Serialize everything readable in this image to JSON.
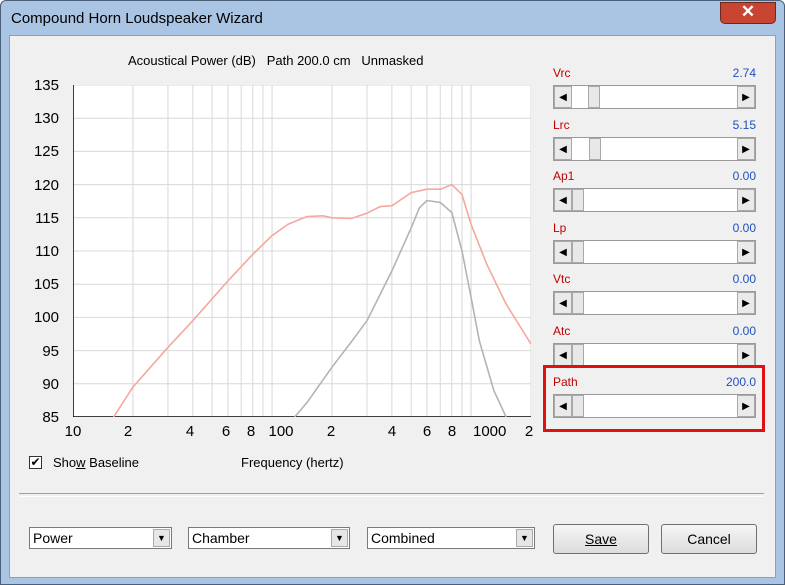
{
  "window": {
    "title": "Compound Horn Loudspeaker Wizard",
    "close_glyph": "✕"
  },
  "chart": {
    "title": "Acoustical Power (dB)   Path 200.0 cm   Unmasked",
    "xaxis_label": "Frequency (hertz)",
    "y_ticks": [
      "135",
      "130",
      "125",
      "120",
      "115",
      "110",
      "105",
      "100",
      "95",
      "90",
      "85"
    ],
    "x_ticks": [
      "10",
      "2",
      "4",
      "6",
      "8",
      "100",
      "2",
      "4",
      "6",
      "8",
      "1000",
      "2"
    ]
  },
  "chart_data": {
    "type": "line",
    "title": "Acoustical Power (dB)   Path 200.0 cm   Unmasked",
    "xlabel": "Frequency (hertz)",
    "ylabel": "",
    "xscale": "log",
    "xlim": [
      10,
      2000
    ],
    "ylim": [
      85,
      135
    ],
    "grid": true,
    "series": [
      {
        "name": "",
        "color": "#f4a8a0",
        "x": [
          16,
          20,
          30,
          40,
          50,
          60,
          80,
          100,
          120,
          150,
          180,
          200,
          250,
          300,
          350,
          400,
          500,
          600,
          700,
          800,
          900,
          1000,
          1200,
          1500,
          2000
        ],
        "y": [
          85,
          89.5,
          95.5,
          99.5,
          102.8,
          105.5,
          109.5,
          112.3,
          114,
          115.2,
          115.3,
          115,
          114.9,
          115.7,
          116.7,
          116.8,
          118.8,
          119.3,
          119.3,
          120,
          118.5,
          114,
          108,
          102,
          96
        ]
      },
      {
        "name": "",
        "color": "#b4b4b4",
        "x": [
          130,
          150,
          200,
          250,
          300,
          400,
          500,
          550,
          600,
          700,
          800,
          900,
          1000,
          1100,
          1300,
          1500
        ],
        "y": [
          85,
          87.2,
          92.5,
          96.3,
          99.5,
          107,
          113.5,
          116.5,
          117.6,
          117.3,
          115.8,
          110,
          103,
          96.5,
          89,
          85
        ]
      }
    ]
  },
  "controls": [
    {
      "label": "Vrc",
      "value": "2.74",
      "level": 0.1
    },
    {
      "label": "Lrc",
      "value": "5.15",
      "level": 0.11
    },
    {
      "label": "Ap1",
      "value": "0.00",
      "level": 0.0
    },
    {
      "label": "Lp",
      "value": "0.00",
      "level": 0.0
    },
    {
      "label": "Vtc",
      "value": "0.00",
      "level": 0.0
    },
    {
      "label": "Atc",
      "value": "0.00",
      "level": 0.0
    },
    {
      "label": "Path",
      "value": "200.0",
      "level": 0.0
    }
  ],
  "show_baseline": {
    "label_pre": "Sho",
    "label_ul": "w",
    "label_post": " Baseline",
    "checked": true,
    "check_glyph": "✔"
  },
  "combos": [
    {
      "value": "Power"
    },
    {
      "value": "Chamber"
    },
    {
      "value": "Combined"
    }
  ],
  "buttons": {
    "save": "Save",
    "cancel": "Cancel"
  },
  "icons": {
    "scroll_left": "◀",
    "scroll_right": "▶",
    "dropdown": "▼"
  },
  "colors": {
    "label_red": "#c00000",
    "value_blue": "#2050c0",
    "highlight": "#e01010"
  }
}
